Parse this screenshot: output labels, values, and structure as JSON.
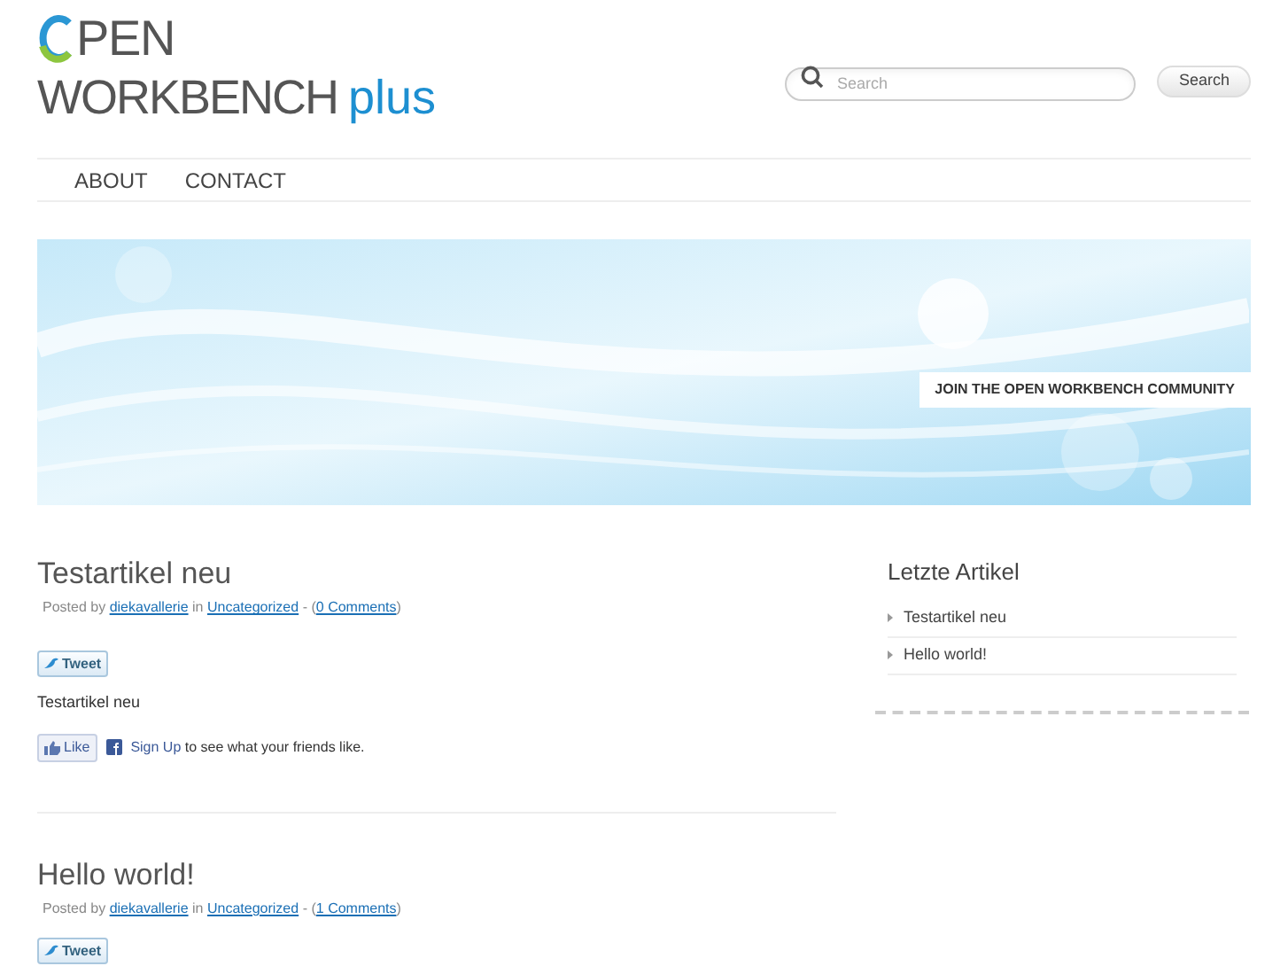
{
  "logo": {
    "line1": "PEN",
    "line2": "WORKBENCH",
    "suffix": "plus"
  },
  "search": {
    "placeholder": "Search",
    "button": "Search"
  },
  "nav": [
    {
      "label": "ABOUT"
    },
    {
      "label": "CONTACT"
    }
  ],
  "banner": {
    "caption": "JOIN THE OPEN WORKBENCH COMMUNITY"
  },
  "posts": [
    {
      "title": "Testartikel neu",
      "meta_prefix": "Posted by",
      "author": "diekavallerie",
      "meta_in": "in",
      "category": "Uncategorized",
      "meta_sep": "-",
      "open": "(",
      "comments": "0 Comments",
      "close": ")",
      "tweet": "Tweet",
      "body": "Testartikel neu",
      "like": "Like",
      "signup": "Sign Up",
      "signup_rest": "to see what your friends like."
    },
    {
      "title": "Hello world!",
      "meta_prefix": "Posted by",
      "author": "diekavallerie",
      "meta_in": "in",
      "category": "Uncategorized",
      "meta_sep": "-",
      "open": "(",
      "comments": "1 Comments",
      "close": ")",
      "tweet": "Tweet"
    }
  ],
  "sidebar": {
    "title": "Letzte Artikel",
    "items": [
      {
        "label": "Testartikel neu"
      },
      {
        "label": "Hello world!"
      }
    ]
  }
}
